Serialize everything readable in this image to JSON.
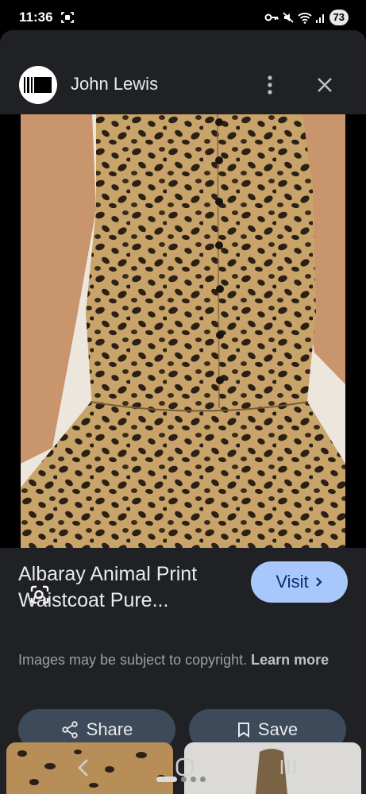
{
  "status_bar": {
    "time": "11:36",
    "battery": "73"
  },
  "header": {
    "source_name": "John Lewis",
    "icons": [
      "source-logo",
      "more-vert-icon",
      "close-icon"
    ]
  },
  "image": {
    "alt": "Albaray Animal Print Waistcoat Pure..."
  },
  "info": {
    "title": "Albaray Animal Print Waistcoat Pure...",
    "visit_label": "Visit",
    "copyright_text": "Images may be subject to copyright.",
    "learn_more": "Learn more"
  },
  "actions": {
    "share_label": "Share",
    "save_label": "Save"
  },
  "colors": {
    "sheet_bg": "#202124",
    "visit_bg": "#a8c7fa",
    "action_bg": "#3c4a59"
  }
}
